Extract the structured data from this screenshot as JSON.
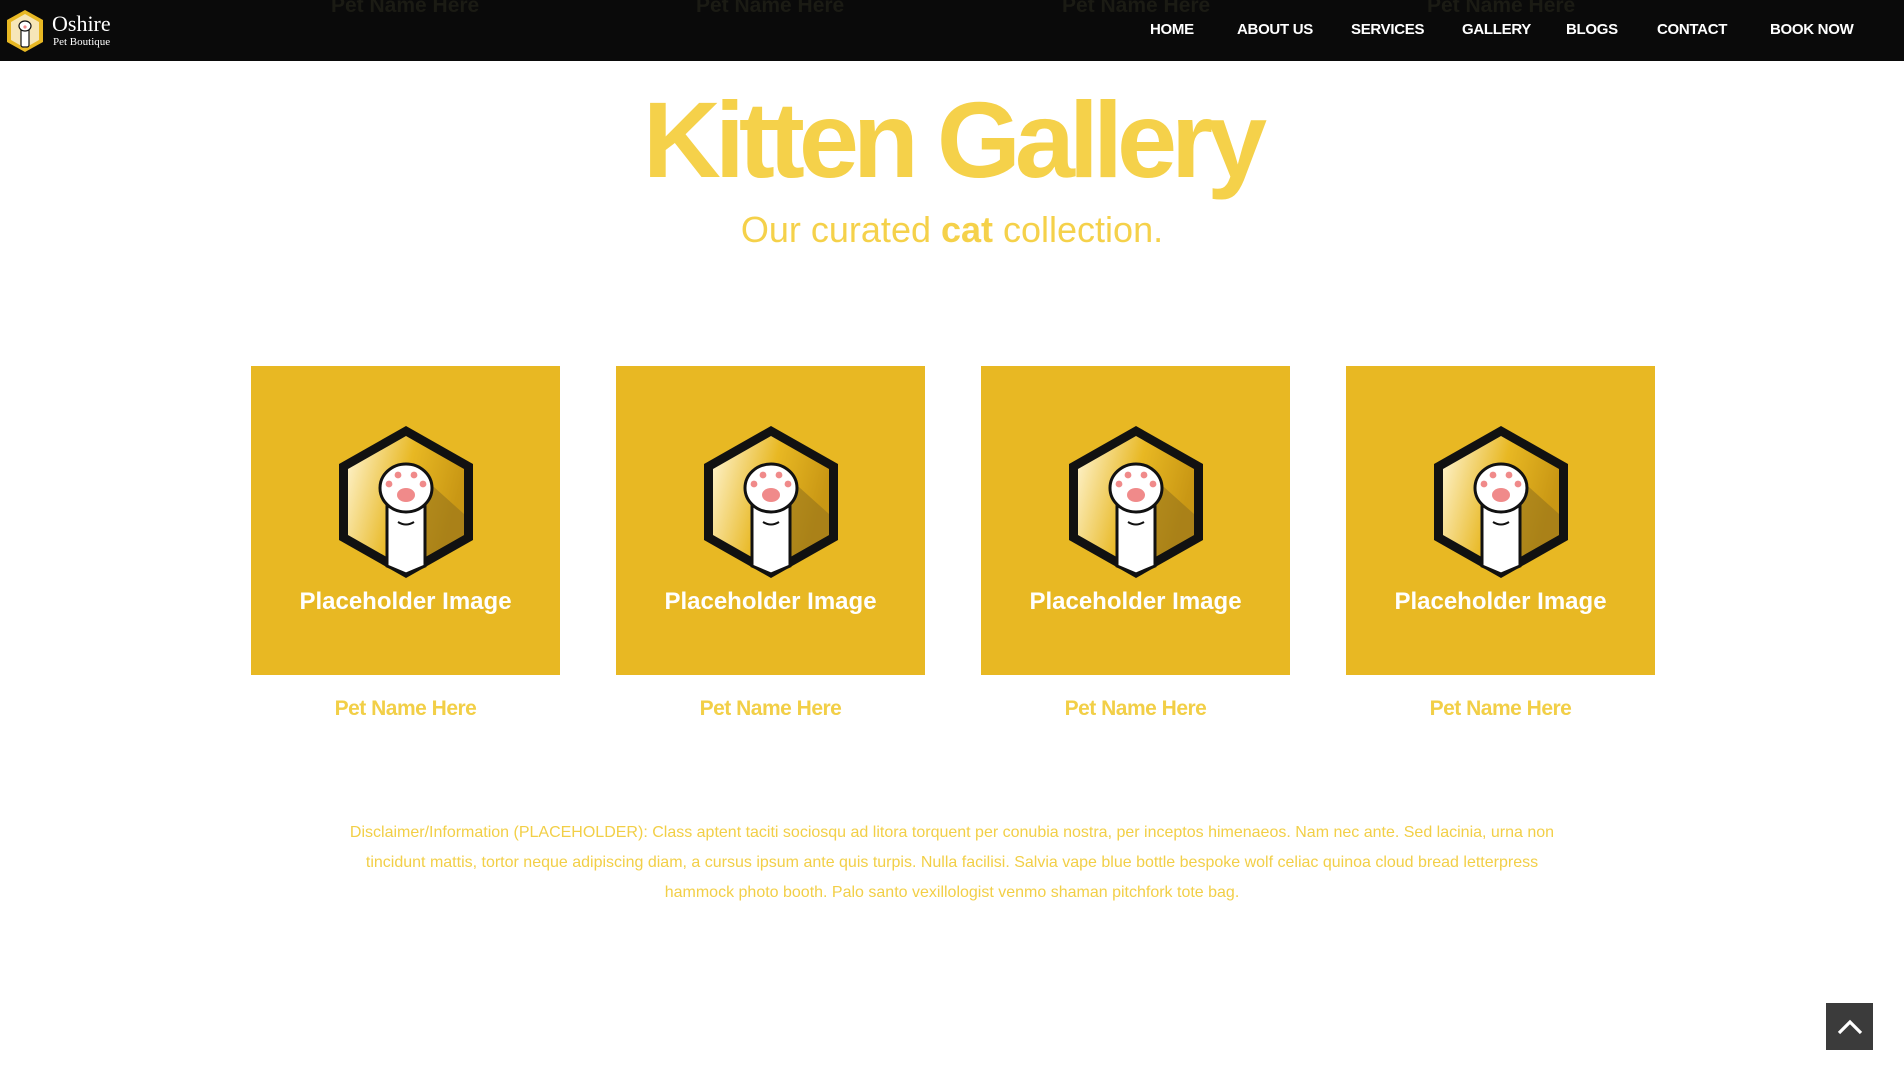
{
  "header": {
    "logo_title": "Oshire",
    "logo_subtitle": "Pet Boutique",
    "ghost_names": [
      "Pet Name Here",
      "Pet Name Here",
      "Pet Name Here",
      "Pet Name Here"
    ],
    "nav": [
      "HOME",
      "ABOUT US",
      "SERVICES",
      "GALLERY",
      "BLOGS",
      "CONTACT",
      "BOOK NOW"
    ]
  },
  "hero": {
    "title": "Kitten Gallery",
    "subtitle_pre": "Our curated ",
    "subtitle_bold": "cat",
    "subtitle_post": " collection."
  },
  "cards": [
    {
      "image_label": "Placeholder Image",
      "name": "Pet Name Here"
    },
    {
      "image_label": "Placeholder Image",
      "name": "Pet Name Here"
    },
    {
      "image_label": "Placeholder Image",
      "name": "Pet Name Here"
    },
    {
      "image_label": "Placeholder Image",
      "name": "Pet Name Here"
    }
  ],
  "disclaimer": "Disclaimer/Information (PLACEHOLDER): Class aptent taciti sociosqu ad litora torquent per conubia nostra, per inceptos himenaeos. Nam nec ante. Sed lacinia, urna non tincidunt mattis, tortor neque adipiscing diam, a cursus ipsum ante quis turpis. Nulla facilisi. Salvia vape blue bottle bespoke wolf celiac quinoa cloud bread letterpress hammock photo booth. Palo santo vexillologist venmo shaman pitchfork tote bag.",
  "colors": {
    "accent": "#f5d14a",
    "card_bg": "#e8b823",
    "header_bg": "#0a0a0a",
    "to_top_bg": "#3b3b3b"
  },
  "icons": {
    "logo": "paw-hexagon-icon",
    "card": "paw-hexagon-icon",
    "to_top": "chevron-up-icon"
  }
}
